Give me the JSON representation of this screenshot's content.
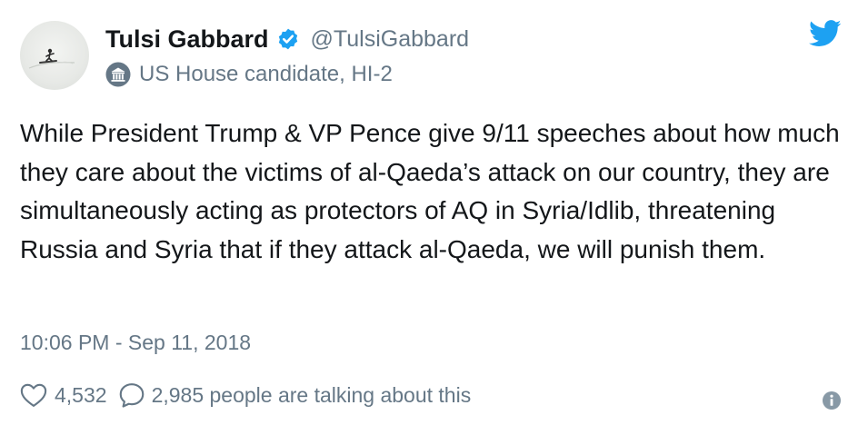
{
  "author": {
    "display_name": "Tulsi Gabbard",
    "handle": "@TulsiGabbard",
    "verified": true,
    "bio": "US House candidate, HI-2",
    "avatar_icon": "surfer-avatar",
    "label_icon": "government-building-icon"
  },
  "tweet": {
    "text": "While President Trump & VP Pence give 9/11 speeches about how much they care about the victims of al-Qaeda’s attack on our country, they are simultaneously acting as protectors of AQ in Syria/Idlib, threatening Russia and Syria that if they attack al-Qaeda, we will punish them.",
    "timestamp": "10:06 PM - Sep 11, 2018"
  },
  "engagement": {
    "likes": "4,532",
    "talking": "2,985 people are talking about this"
  },
  "colors": {
    "text": "#14171a",
    "muted": "#657786",
    "brand_blue": "#1da1f2"
  }
}
